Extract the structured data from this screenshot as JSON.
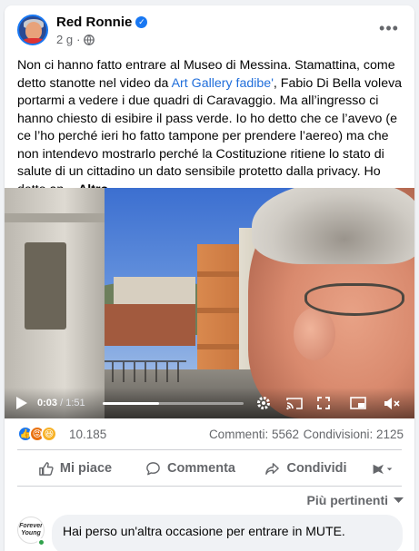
{
  "post": {
    "author": "Red Ronnie",
    "time": "2 g",
    "text_before": "Non ci hanno fatto entrare al Museo di Messina. Stamattina, come detto stanotte nel video da ",
    "link_text": "Art Gallery fadibe'",
    "text_after": ", Fabio Di Bella voleva portarmi a vedere i due quadri di Caravaggio. Ma all’ingresso ci hanno chiesto di esibire il pass verde. Io ho detto che ce l’avevo (e ce l’ho perché ieri ho fatto tampone per prendere l’aereo) ma che non intendevo mostrarlo perché la Costituzione ritiene lo stato di salute di un cittadino un dato sensibile protetto dalla privacy. Ho detto an... ",
    "more_label": "Altro...",
    "icons": {
      "verified": "verified-badge-icon",
      "privacy": "globe-icon",
      "menu": "more-options-icon"
    }
  },
  "video": {
    "current_time": "0:03",
    "duration": "/ 1:51",
    "progress_fraction": 0.4,
    "icons": [
      "play-icon",
      "settings-icon",
      "cast-icon",
      "fullscreen-icon",
      "picture-in-picture-icon",
      "mute-icon"
    ]
  },
  "stats": {
    "reaction_count": "10.185",
    "comments": "Commenti: 5562",
    "shares": "Condivisioni: 2125"
  },
  "actions": {
    "like": "Mi piace",
    "comment": "Commenta",
    "share": "Condividi"
  },
  "comments_section": {
    "sort_label": "Più pertinenti",
    "avatar_text": "Forever Young",
    "first_comment": "Hai perso un'altra occasione per entrare in MUTE."
  },
  "colors": {
    "accent": "#1877f2",
    "link": "#216fdb",
    "muted": "#65676b"
  }
}
